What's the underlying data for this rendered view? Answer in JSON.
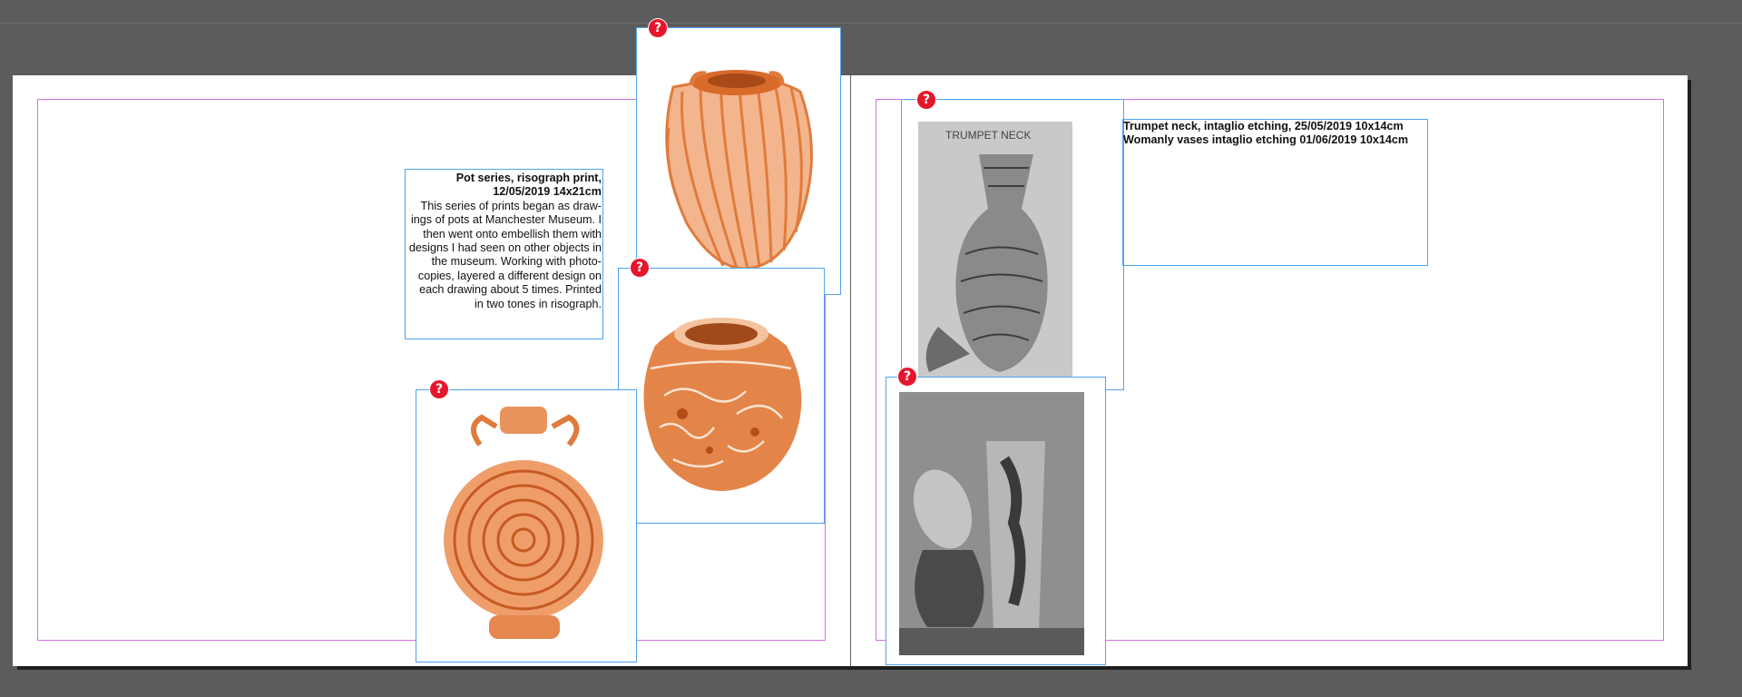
{
  "document": {
    "left_page": {
      "caption": {
        "title_line1": "Pot series, risograph print,",
        "title_line2": "12/05/2019  14x21cm",
        "body": "This series of prints began as draw-ings of pots at Manchester Museum. I then went onto embellish them with designs I had seen on other objects in the museum. Working with photo-copies, layered a different design on each drawing about 5 times. Printed in two tones in risograph."
      },
      "images": [
        {
          "name": "pot-ribbed",
          "missing_link_glyph": "?"
        },
        {
          "name": "pot-round-decorated",
          "missing_link_glyph": "?"
        },
        {
          "name": "pot-flask",
          "missing_link_glyph": "?"
        }
      ]
    },
    "right_page": {
      "caption": {
        "line1": "Trumpet neck, intaglio etching, 25/05/2019 10x14cm",
        "line2": "Womanly vases intaglio etching 01/06/2019 10x14cm"
      },
      "etching_inscription": "TRUMPET NECK",
      "images": [
        {
          "name": "etching-trumpet-neck",
          "missing_link_glyph": "?"
        },
        {
          "name": "etching-womanly-vases",
          "missing_link_glyph": "?"
        }
      ]
    }
  },
  "colors": {
    "pasteboard": "#5c5c5c",
    "frame_edge": "#4ea3f1",
    "margin_guide": "#d56ee6",
    "missing_link_badge": "#e5162b",
    "riso_orange": "#e07b3c",
    "etching_gray": "#6b6b6b"
  }
}
